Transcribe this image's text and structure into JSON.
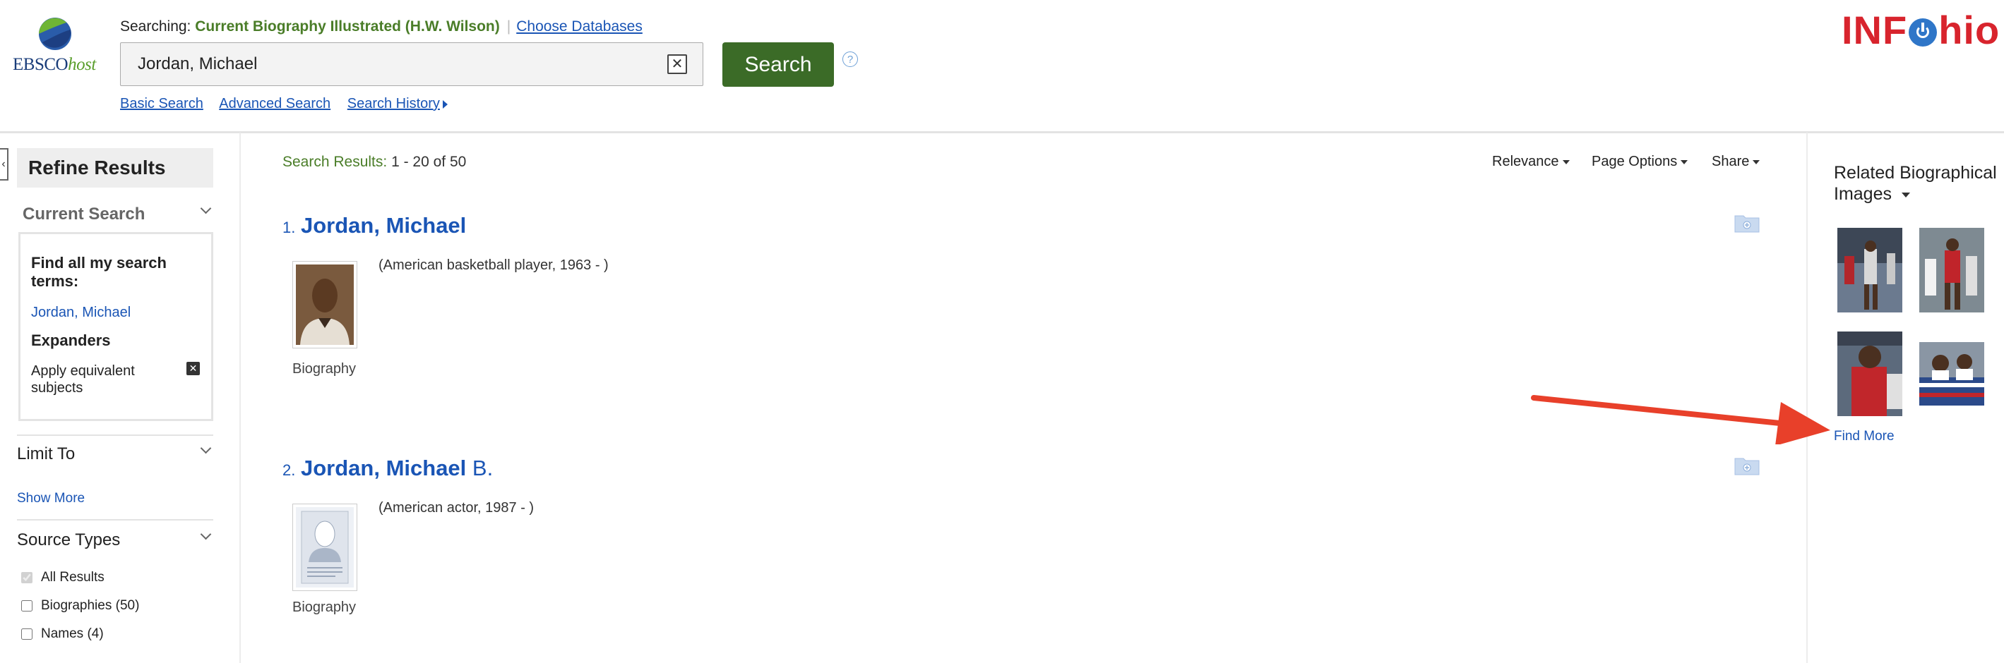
{
  "header": {
    "logo_text": "EBSCOhost",
    "searching_label": "Searching:",
    "database_name": "Current Biography Illustrated (H.W. Wilson)",
    "choose_databases_label": "Choose Databases",
    "search_value": "Jordan, Michael",
    "search_button_label": "Search",
    "help_label": "?",
    "nav": {
      "basic_search": "Basic Search",
      "advanced_search": "Advanced Search",
      "search_history": "Search History"
    },
    "brand_logo": "INFOhio"
  },
  "sidebar": {
    "title": "Refine Results",
    "current_search": {
      "title": "Current Search",
      "find_terms_label": "Find all my search terms:",
      "find_terms_value": "Jordan, Michael",
      "expanders_label": "Expanders",
      "expander_item": "Apply equivalent subjects"
    },
    "limit_to_title": "Limit To",
    "show_more_label": "Show More",
    "source_types": {
      "title": "Source Types",
      "items": [
        {
          "label": "All Results",
          "checked": true,
          "disabled": true
        },
        {
          "label": "Biographies (50)",
          "checked": false
        },
        {
          "label": "Names (4)",
          "checked": false
        }
      ]
    }
  },
  "results": {
    "count_label": "Search Results:",
    "count_value": "1 - 20 of 50",
    "sort_label": "Relevance",
    "page_options_label": "Page Options",
    "share_label": "Share",
    "items": [
      {
        "number": "1.",
        "title_bold": "Jordan, Michael",
        "title_rest": "",
        "description": "(American basketball player, 1963 - )",
        "type": "Biography",
        "thumb": "photo"
      },
      {
        "number": "2.",
        "title_bold": "Jordan, Michael",
        "title_rest": " B.",
        "description": "(American actor, 1987 - )",
        "type": "Biography",
        "thumb": "placeholder"
      }
    ]
  },
  "related": {
    "title": "Related Biographical Images",
    "find_more_label": "Find More"
  },
  "colors": {
    "link": "#1a55b5",
    "green": "#3b6b27",
    "brand_red": "#d8242d",
    "arrow": "#e8402a"
  }
}
